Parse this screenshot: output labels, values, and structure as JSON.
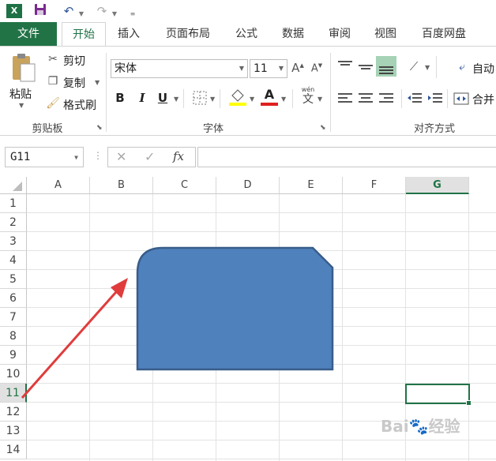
{
  "qat": {
    "logo": "X"
  },
  "tabs": [
    "文件",
    "开始",
    "插入",
    "页面布局",
    "公式",
    "数据",
    "审阅",
    "视图",
    "百度网盘"
  ],
  "clipboard": {
    "paste": "粘贴",
    "cut": "剪切",
    "copy": "复制",
    "format_painter": "格式刷",
    "label": "剪贴板"
  },
  "font": {
    "name": "宋体",
    "size": "11",
    "bold": "B",
    "italic": "I",
    "underline": "U",
    "font_color": "A",
    "wen": "wén",
    "wen2": "文",
    "label": "字体"
  },
  "alignment": {
    "wrap": "自动",
    "merge": "合并",
    "label": "对齐方式"
  },
  "formula_bar": {
    "name_box": "G11",
    "fx": "fx",
    "cancel": "✕",
    "confirm": "✓",
    "value": ""
  },
  "grid": {
    "columns": [
      "A",
      "B",
      "C",
      "D",
      "E",
      "F",
      "G"
    ],
    "rows": [
      "1",
      "2",
      "3",
      "4",
      "5",
      "6",
      "7",
      "8",
      "9",
      "10",
      "11",
      "12",
      "13",
      "14"
    ],
    "selected_column": "G",
    "selected_row": "11",
    "active_cell": "G11"
  },
  "shape": {
    "fill": "#4f81bd",
    "stroke": "#385d8a"
  },
  "arrow": {
    "color": "#e03c3c"
  },
  "colors": {
    "accent": "#217346"
  }
}
